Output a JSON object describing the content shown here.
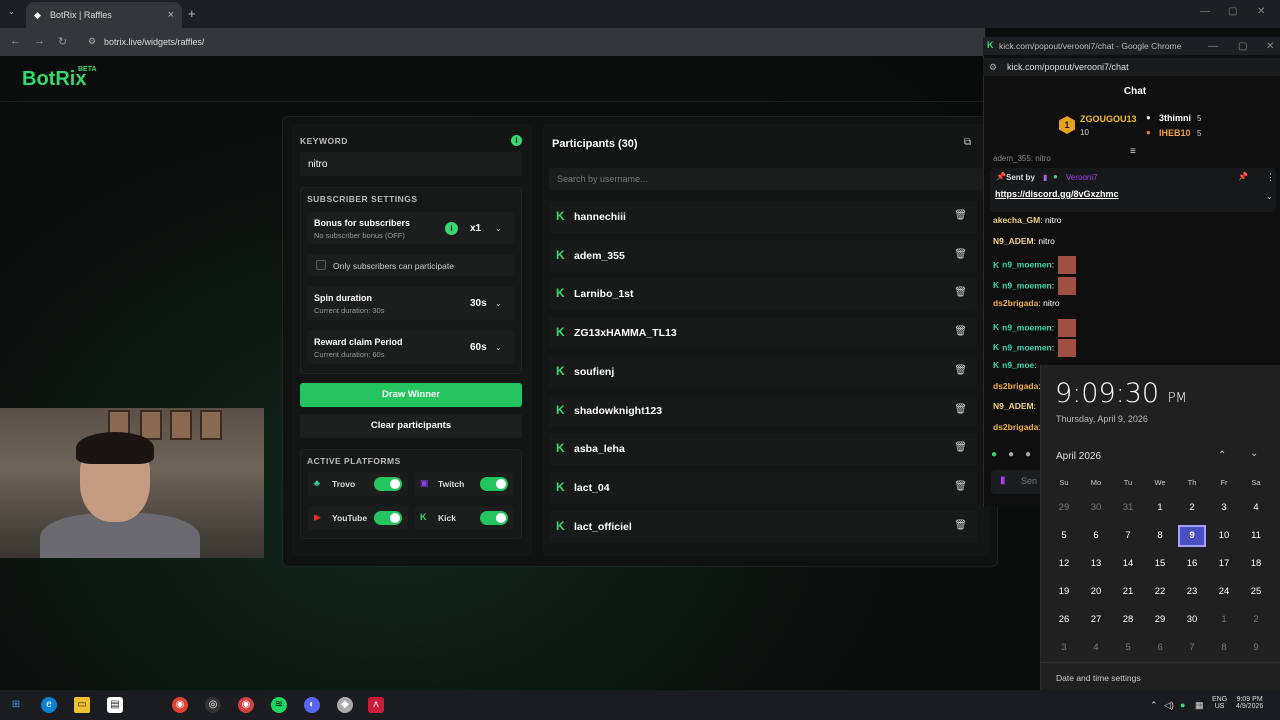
{
  "browser": {
    "tab_title": "BotRix | Raffles",
    "url": "botrix.live/widgets/raffles/"
  },
  "app": {
    "logo": "BotRix",
    "badge": "BETA"
  },
  "raffle": {
    "keyword_label": "KEYWORD",
    "keyword_value": "nitro",
    "subscriber_settings_label": "SUBSCRIBER SETTINGS",
    "bonus_title": "Bonus for subscribers",
    "bonus_sub": "No subscriber bonus (OFF)",
    "bonus_value": "x1",
    "only_subs_label": "Only subscribers can participate",
    "spin_title": "Spin duration",
    "spin_sub": "Current duration: 30s",
    "spin_value": "30s",
    "claim_title": "Reward claim Period",
    "claim_sub": "Current duration: 60s",
    "claim_value": "60s",
    "draw_button": "Draw Winner",
    "clear_button": "Clear participants",
    "platforms_label": "ACTIVE PLATFORMS",
    "platforms": [
      {
        "name": "Trovo",
        "enabled": true
      },
      {
        "name": "Twitch",
        "enabled": true
      },
      {
        "name": "YouTube",
        "enabled": true
      },
      {
        "name": "Kick",
        "enabled": true
      }
    ]
  },
  "participants": {
    "title": "Participants (30)",
    "search_placeholder": "Search by username...",
    "list": [
      "hannechiii",
      "adem_355",
      "Larnibo_1st",
      "ZG13xHAMMA_TL13",
      "soufienj",
      "shadowknight123",
      "asba_leha",
      "lact_04",
      "lact_officiel"
    ]
  },
  "chat_window": {
    "window_title": "kick.com/popout/verooni7/chat - Google Chrome",
    "url": "kick.com/popout/verooni7/chat",
    "header": "Chat",
    "leader1": "ZGOUGOU13",
    "leader1_count": "10",
    "leader2": "3thimni",
    "leader2_count": "5",
    "leader3": "IHEB10",
    "leader3_count": "5",
    "partial_top": "adem_355: nitro",
    "pinned_sent_by": "Sent by",
    "pinned_user": "Verooni7",
    "pinned_link": "https://discord.gg/8vGxzhmc",
    "messages": [
      {
        "user": "akecha_GM",
        "text": "nitro",
        "color": "#f0d080"
      },
      {
        "user": "N9_ADEM",
        "text": "nitro",
        "color": "#f0d080"
      },
      {
        "user": "n9_moemen",
        "text": "",
        "color": "#37d9b0"
      },
      {
        "user": "n9_moemen",
        "text": "",
        "color": "#37d9b0"
      },
      {
        "user": "ds2brigada",
        "text": "nitro",
        "color": "#f0b040"
      },
      {
        "user": "n9_moemen",
        "text": "",
        "color": "#37d9b0"
      },
      {
        "user": "n9_moemen",
        "text": "",
        "color": "#37d9b0"
      },
      {
        "user": "n9_moe",
        "text": "",
        "color": "#37d9b0"
      },
      {
        "user": "ds2brigada",
        "text": "",
        "color": "#f0b040"
      },
      {
        "user": "N9_ADEM",
        "text": "",
        "color": "#f0d080"
      },
      {
        "user": "ds2brigada",
        "text": "",
        "color": "#f0b040"
      }
    ],
    "send_placeholder": "Sen"
  },
  "clock": {
    "time": "9:09:30",
    "ampm": "PM",
    "date": "Thursday, April 9, 2026",
    "month": "April 2026",
    "weekdays": [
      "Su",
      "Mo",
      "Tu",
      "We",
      "Th",
      "Fr",
      "Sa"
    ],
    "weeks": [
      [
        "29",
        "30",
        "31",
        "1",
        "2",
        "3",
        "4"
      ],
      [
        "5",
        "6",
        "7",
        "8",
        "9",
        "10",
        "11"
      ],
      [
        "12",
        "13",
        "14",
        "15",
        "16",
        "17",
        "18"
      ],
      [
        "19",
        "20",
        "21",
        "22",
        "23",
        "24",
        "25"
      ],
      [
        "26",
        "27",
        "28",
        "29",
        "30",
        "1",
        "2"
      ],
      [
        "3",
        "4",
        "5",
        "6",
        "7",
        "8",
        "9"
      ]
    ],
    "today": "9",
    "settings_link": "Date and time settings"
  },
  "taskbar": {
    "lang": "ENG",
    "region": "US",
    "time": "9:09 PM",
    "date": "4/9/2026"
  }
}
